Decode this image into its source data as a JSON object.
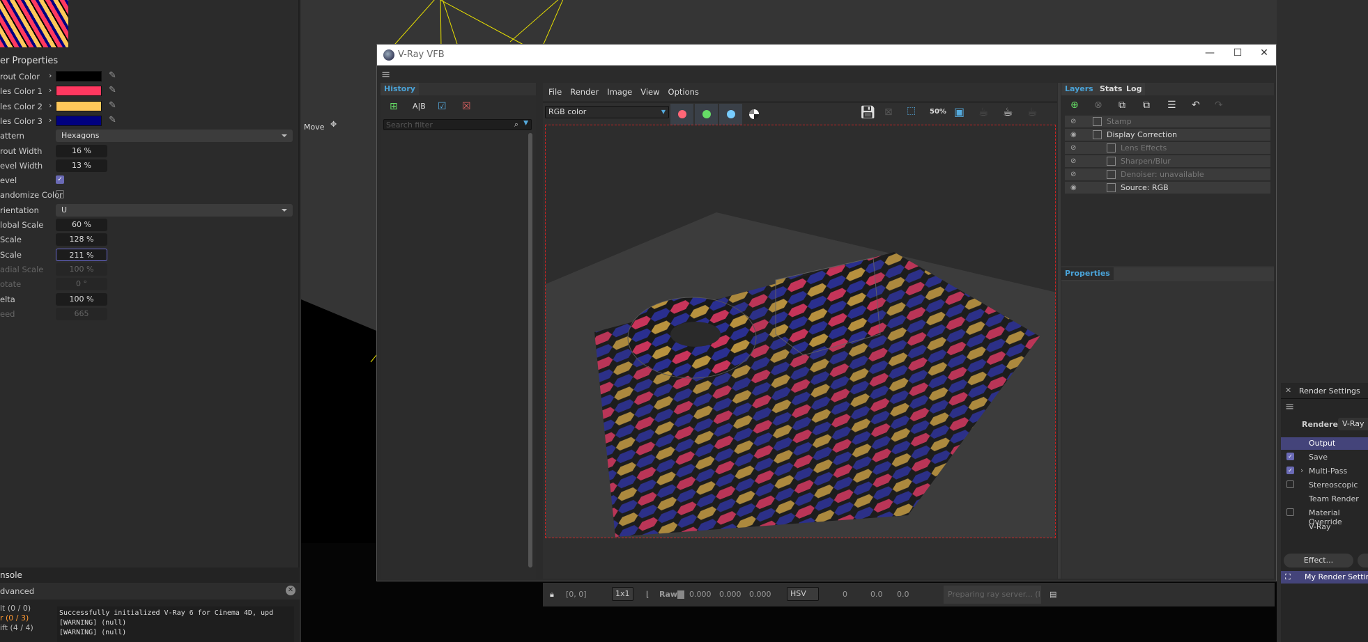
{
  "left_panel": {
    "title": "er Properties",
    "rows": [
      {
        "label": "rout Color",
        "type": "color",
        "color": "#000000"
      },
      {
        "label": "les Color 1",
        "type": "color",
        "color": "#ff3860"
      },
      {
        "label": "les Color 2",
        "type": "color",
        "color": "#ffc85a"
      },
      {
        "label": "les Color 3",
        "type": "color",
        "color": "#000080"
      },
      {
        "label": "attern",
        "type": "dropdown",
        "value": "Hexagons"
      },
      {
        "label": "rout Width",
        "type": "field",
        "value": "16 %"
      },
      {
        "label": "evel Width",
        "type": "field",
        "value": "13 %"
      },
      {
        "label": "evel",
        "type": "checkbox",
        "checked": true
      },
      {
        "label": "andomize Color",
        "type": "checkbox",
        "checked": false
      },
      {
        "label": "rientation",
        "type": "dropdown",
        "value": "U"
      },
      {
        "label": "lobal Scale",
        "type": "field",
        "value": "60 %"
      },
      {
        "label": "Scale",
        "type": "field",
        "value": "128 %"
      },
      {
        "label": "Scale",
        "type": "field",
        "value": "211 %",
        "focused": true
      },
      {
        "label": "adial Scale",
        "type": "field",
        "value": "100 %",
        "disabled": true
      },
      {
        "label": "otate",
        "type": "field",
        "value": "0 °",
        "disabled": true
      },
      {
        "label": "elta",
        "type": "field",
        "value": "100 %"
      },
      {
        "label": "eed",
        "type": "field",
        "value": "665",
        "disabled": true
      }
    ]
  },
  "console": {
    "title": "nsole",
    "filter": "dvanced",
    "categories": [
      "lt (0 / 0)",
      "r (0 / 3)",
      "ift (4 / 4)"
    ],
    "lines": [
      "Successfully initialized V-Ray 6 for Cinema 4D, upd",
      "[WARNING] (null)",
      "[WARNING] (null)"
    ]
  },
  "viewport": {
    "move_label": "Move"
  },
  "vfb": {
    "title": "V-Ray VFB",
    "history": {
      "tab": "History",
      "search_placeholder": "Search filter"
    },
    "menu": [
      "File",
      "Render",
      "Image",
      "View",
      "Options"
    ],
    "channel": "RGB color",
    "zoom_label": "50%",
    "right_tabs": [
      "Layers",
      "Stats",
      "Log"
    ],
    "layers": [
      {
        "name": "Stamp",
        "visible": false,
        "indent": 0
      },
      {
        "name": "Display Correction",
        "visible": true,
        "indent": 0
      },
      {
        "name": "Lens Effects",
        "visible": false,
        "indent": 1
      },
      {
        "name": "Sharpen/Blur",
        "visible": false,
        "indent": 1
      },
      {
        "name": "Denoiser: unavailable",
        "visible": false,
        "indent": 1
      },
      {
        "name": "Source: RGB",
        "visible": true,
        "indent": 1
      }
    ],
    "properties_tab": "Properties",
    "status": {
      "coords": "[0, 0]",
      "sample": "1x1",
      "raw": "Raw",
      "rgb": [
        "0.000",
        "0.000",
        "0.000"
      ],
      "colorspace": "HSV",
      "hsv": [
        "0",
        "0.0",
        "0.0"
      ],
      "progress": "Preparing ray server... (I"
    }
  },
  "render_settings": {
    "title": "Render Settings",
    "renderer_label": "Renderer",
    "renderer": "V-Ray",
    "items": [
      {
        "label": "Output",
        "checkbox": null,
        "selected": true
      },
      {
        "label": "Save",
        "checkbox": true
      },
      {
        "label": "Multi-Pass",
        "checkbox": true,
        "expandable": true
      },
      {
        "label": "Stereoscopic",
        "checkbox": false
      },
      {
        "label": "Team Render",
        "checkbox": null
      },
      {
        "label": "Material Override",
        "checkbox": false
      },
      {
        "label": "V-Ray",
        "checkbox": null
      }
    ],
    "effect_button": "Effect...",
    "preset": "My Render Settings"
  }
}
